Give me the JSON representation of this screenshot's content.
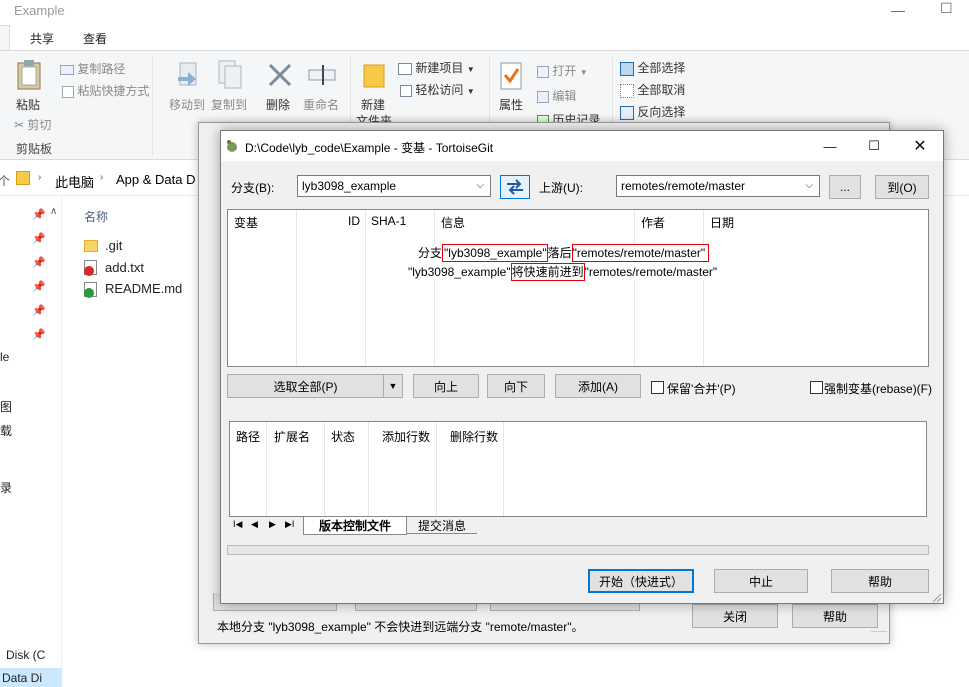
{
  "explorer": {
    "window_title": "Example",
    "tabs": [
      "共享",
      "查看"
    ],
    "ribbon": {
      "pin_label": "粘贴",
      "copy_path": "复制路径",
      "paste_shortcut": "粘贴快捷方式",
      "cut": "剪切",
      "clipboard_group": "剪贴板",
      "move_to": "移动到",
      "copy_to": "复制到",
      "delete": "删除",
      "rename": "重命名",
      "new_folder": "新建",
      "new_folder_2": "文件夹",
      "new_item": "新建项目",
      "easy_access": "轻松访问",
      "properties": "属性",
      "open": "打开",
      "edit": "编辑",
      "history": "历史记录",
      "select_all": "全部选择",
      "select_none": "全部取消",
      "invert_selection": "反向选择"
    },
    "address": {
      "this_pc": "此电脑",
      "app_data": "App & Data D"
    },
    "nav_fragments": [
      "le",
      "图",
      "载",
      "录"
    ],
    "bottom_fragments": [
      "Disk (C",
      "Data Di"
    ],
    "files": {
      "header": "名称",
      "items": [
        ".git",
        "add.txt",
        "README.md"
      ]
    }
  },
  "behind_dialog": {
    "status_text": "本地分支 \"lyb3098_example\" 不会快进到远端分支 \"remote/master\"。",
    "close_button": "关闭",
    "help_button": "帮助"
  },
  "dialog": {
    "title": "D:\\Code\\lyb_code\\Example - 变基 - TortoiseGit",
    "branch_label": "分支(B):",
    "branch_value": "lyb3098_example",
    "upstream_label": "上游(U):",
    "upstream_value": "remotes/remote/master",
    "browse_button": "...",
    "to_button": "到(O)",
    "columns": [
      "变基",
      "ID",
      "SHA-1",
      "信息",
      "作者",
      "日期"
    ],
    "message_line1": {
      "prefix": "分支",
      "branch": "\"lyb3098_example\"",
      "middle": "落后",
      "upstream": "\"remotes/remote/master\""
    },
    "message_line2": {
      "branch": "\"lyb3098_example\"",
      "middle": "将快速前进到",
      "upstream": "\"remotes/remote/master\""
    },
    "select_all_button": "选取全部(P)",
    "up_button": "向上",
    "down_button": "向下",
    "add_button": "添加(A)",
    "preserve_merge": "保留'合并'(P)",
    "force_rebase": "强制变基(rebase)(F)",
    "file_columns": [
      "路径",
      "扩展名",
      "状态",
      "添加行数",
      "删除行数"
    ],
    "bottom_tabs": [
      "版本控制文件",
      "提交消息"
    ],
    "start_button": "开始（快进式）",
    "abort_button": "中止",
    "help_button": "帮助"
  }
}
